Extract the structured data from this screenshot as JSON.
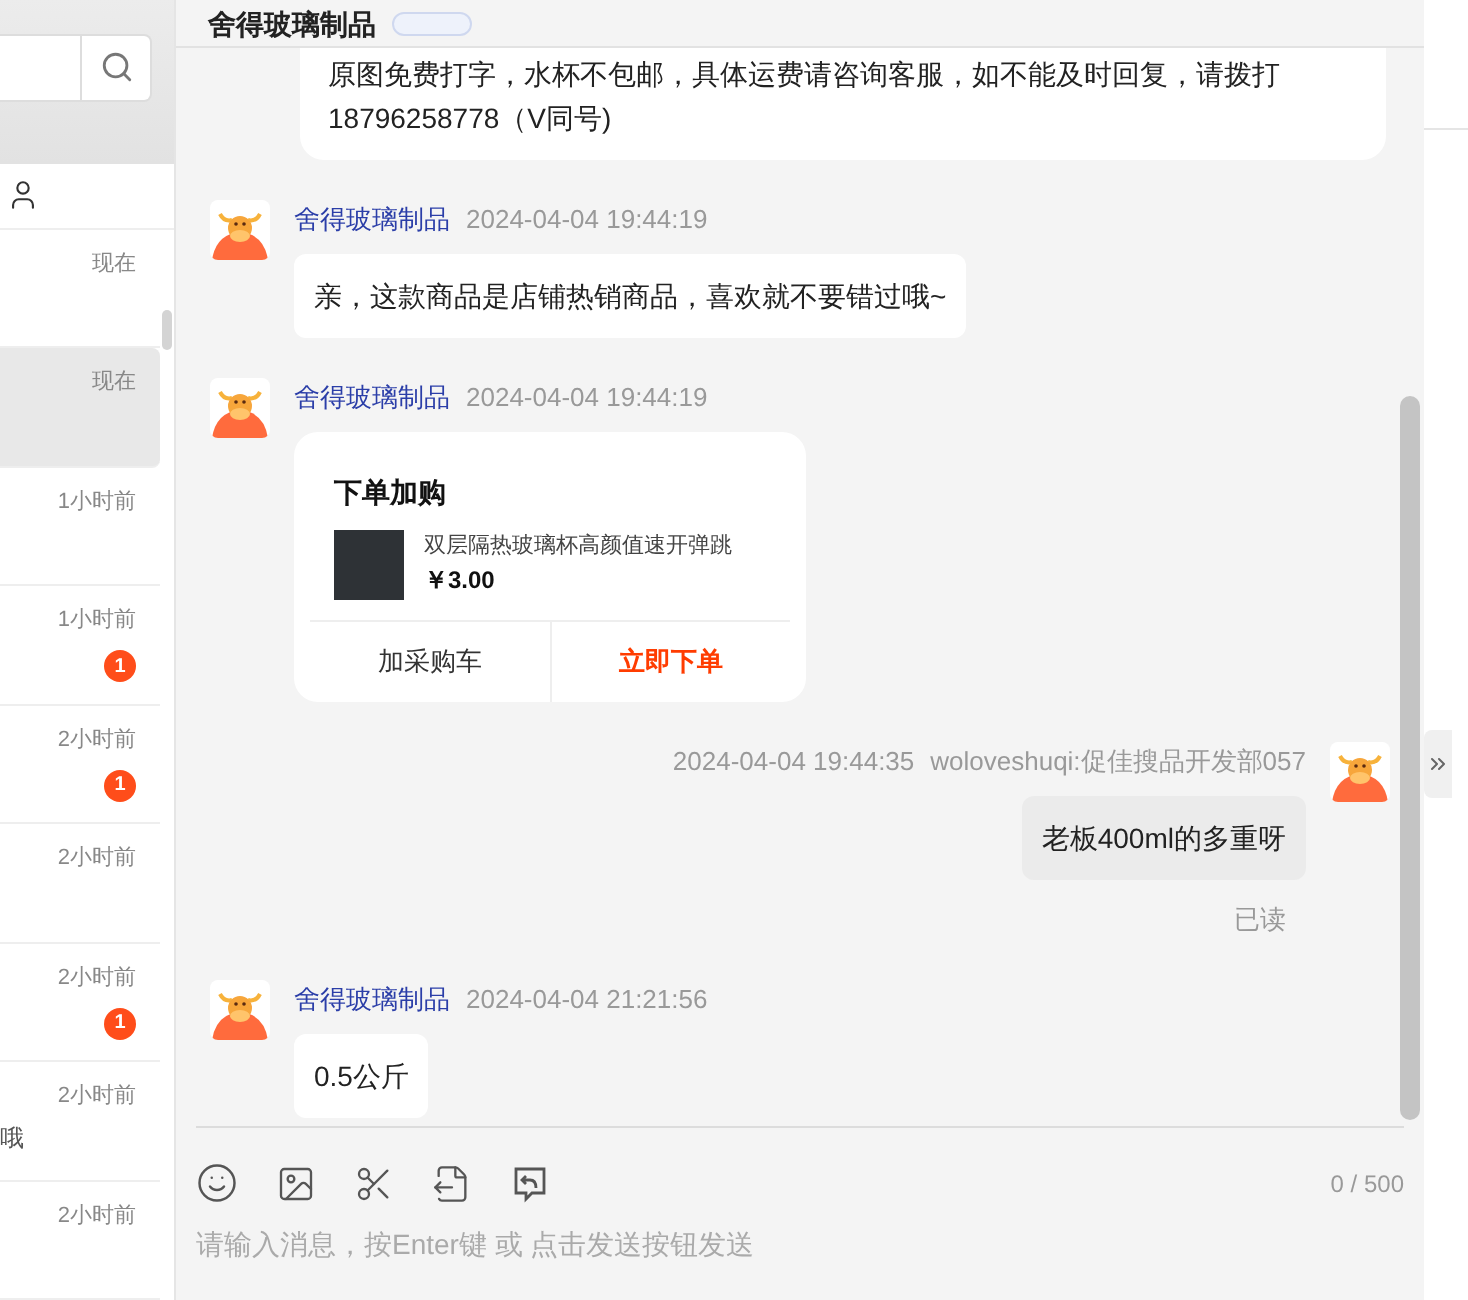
{
  "sidebar": {
    "conversations": [
      {
        "time": "现在",
        "selected": false
      },
      {
        "time": "现在",
        "selected": true
      },
      {
        "time": "1小时前",
        "selected": false
      },
      {
        "time": "1小时前",
        "selected": false,
        "badge": "1"
      },
      {
        "time": "2小时前",
        "selected": false,
        "badge": "1"
      },
      {
        "time": "2小时前",
        "selected": false
      },
      {
        "time": "2小时前",
        "selected": false,
        "badge": "1"
      },
      {
        "time": "2小时前",
        "selected": false,
        "preview": "哦"
      },
      {
        "time": "2小时前",
        "selected": false
      }
    ]
  },
  "chat": {
    "title": "舍得玻璃制品",
    "messages": [
      {
        "kind": "text",
        "outgoing": false,
        "continued": true,
        "text": "原图免费打字，水杯不包邮，具体运费请咨询客服，如不能及时回复，请拨打18796258778（V同号)"
      },
      {
        "kind": "text",
        "outgoing": false,
        "sender": "舍得玻璃制品",
        "time": "2024-04-04 19:44:19",
        "text": "亲，这款商品是店铺热销商品，喜欢就不要错过哦~"
      },
      {
        "kind": "product_card",
        "outgoing": false,
        "sender": "舍得玻璃制品",
        "time": "2024-04-04 19:44:19",
        "card": {
          "title": "下单加购",
          "product": "双层隔热玻璃杯高颜值速开弹跳",
          "price": "￥3.00",
          "buttons": [
            "加采购车",
            "立即下单"
          ]
        }
      },
      {
        "kind": "text",
        "outgoing": true,
        "sender": "woloveshuqi:促佳搜品开发部057",
        "time": "2024-04-04 19:44:35",
        "text": "老板400ml的多重呀",
        "status": "已读"
      },
      {
        "kind": "text",
        "outgoing": false,
        "sender": "舍得玻璃制品",
        "time": "2024-04-04 21:21:56",
        "text": "0.5公斤"
      }
    ],
    "composer": {
      "counter": "0 / 500",
      "placeholder": "请输入消息，按Enter键 或 点击发送按钮发送"
    }
  }
}
